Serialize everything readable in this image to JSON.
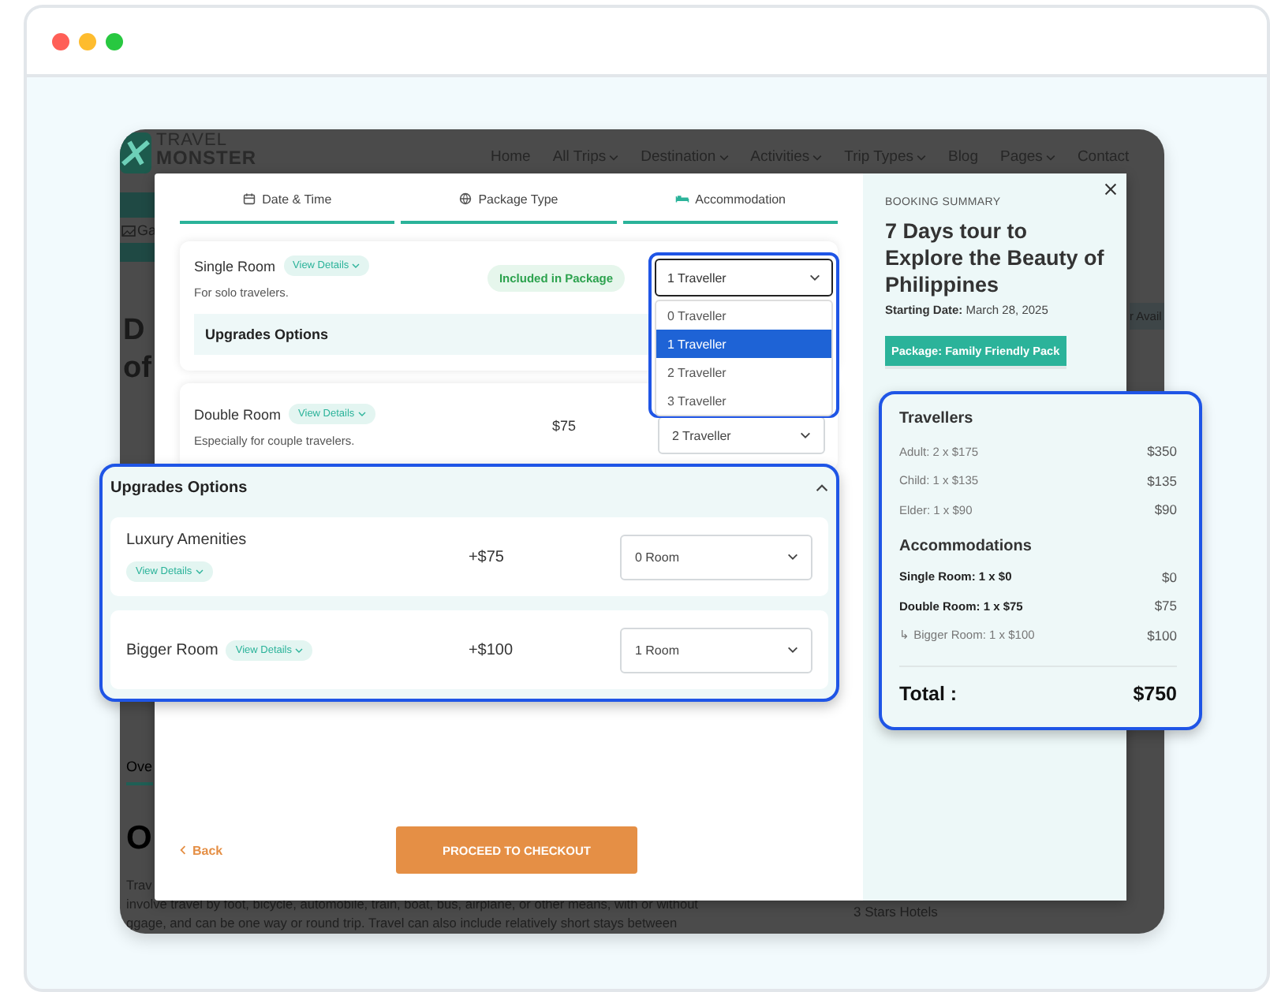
{
  "browser": {
    "dots": [
      {
        "color": "#ff5f57"
      },
      {
        "color": "#febc2e"
      },
      {
        "color": "#28c840"
      }
    ]
  },
  "site": {
    "logo_top": "TRAVEL",
    "logo_bottom": "MONSTER",
    "nav": [
      {
        "label": "Home",
        "dropdown": false
      },
      {
        "label": "All Trips",
        "dropdown": true
      },
      {
        "label": "Destination",
        "dropdown": true
      },
      {
        "label": "Activities",
        "dropdown": true
      },
      {
        "label": "Trip Types",
        "dropdown": true
      },
      {
        "label": "Blog",
        "dropdown": false
      },
      {
        "label": "Pages",
        "dropdown": true
      },
      {
        "label": "Contact",
        "dropdown": false
      }
    ],
    "gallery_tab": "Ga",
    "title_lines": [
      "D",
      "of"
    ],
    "avail": "r Avail",
    "overview_tab": "Ove",
    "overview_heading": "O",
    "paragraph_lines": [
      "Trav",
      "involve travel by foot, bicycle, automobile, train, boat, bus, airplane, or other means, with or without",
      "ggage, and can be one way or round trip. Travel can also include relatively short stays between"
    ],
    "hotels": "3 Stars Hotels"
  },
  "steps": [
    {
      "label": "Date & Time"
    },
    {
      "label": "Package Type"
    },
    {
      "label": "Accommodation"
    }
  ],
  "rooms": [
    {
      "name": "Single Room",
      "details": "View Details",
      "description": "For solo travelers.",
      "kind": "badge",
      "price": "Included in Package",
      "upgrades": "Upgrades Options"
    },
    {
      "name": "Double Room",
      "details": "View Details",
      "description": "Especially for couple travelers.",
      "kind": "text",
      "price": "$75",
      "select": "2 Traveller"
    }
  ],
  "traveller_dropdown": {
    "value": "1 Traveller",
    "options": [
      {
        "label": "0 Traveller",
        "selected": false
      },
      {
        "label": "1 Traveller",
        "selected": true
      },
      {
        "label": "2 Traveller",
        "selected": false
      },
      {
        "label": "3 Traveller",
        "selected": false
      }
    ]
  },
  "upgrades": {
    "title": "Upgrades Options",
    "expanded": true,
    "items": [
      {
        "name": "Luxury Amenities",
        "details": "View Details",
        "kind": "stacked",
        "price": "+$75",
        "select": "0 Room"
      },
      {
        "name": "Bigger Room",
        "details": "View Details",
        "kind": "inline",
        "price": "+$100",
        "select": "1 Room"
      }
    ]
  },
  "back": "Back",
  "checkout": "PROCEED TO CHECKOUT",
  "summary": {
    "label": "BOOKING SUMMARY",
    "title": "7 Days tour to Explore the Beauty of Philippines",
    "date_label": "Starting Date:",
    "date": "March 28, 2025",
    "package": "Package: Family Friendly Pack",
    "travellers_heading": "Travellers",
    "travellers": [
      {
        "label": "Adult: 2 x $175",
        "amount": "$350"
      },
      {
        "label": "Child: 1 x $135",
        "amount": "$135"
      },
      {
        "label": "Elder: 1 x $90",
        "amount": "$90"
      }
    ],
    "accommodations_heading": "Accommodations",
    "accommodations": [
      {
        "label": "Single Room: 1 x $0",
        "amount": "$0",
        "kind": "room"
      },
      {
        "label": "Double Room: 1 x $75",
        "amount": "$75",
        "kind": "room"
      },
      {
        "label": "↳ Bigger Room: 1 x $100",
        "amount": "$100",
        "kind": "upgrade"
      }
    ],
    "total_label": "Total :",
    "total": "$750"
  }
}
